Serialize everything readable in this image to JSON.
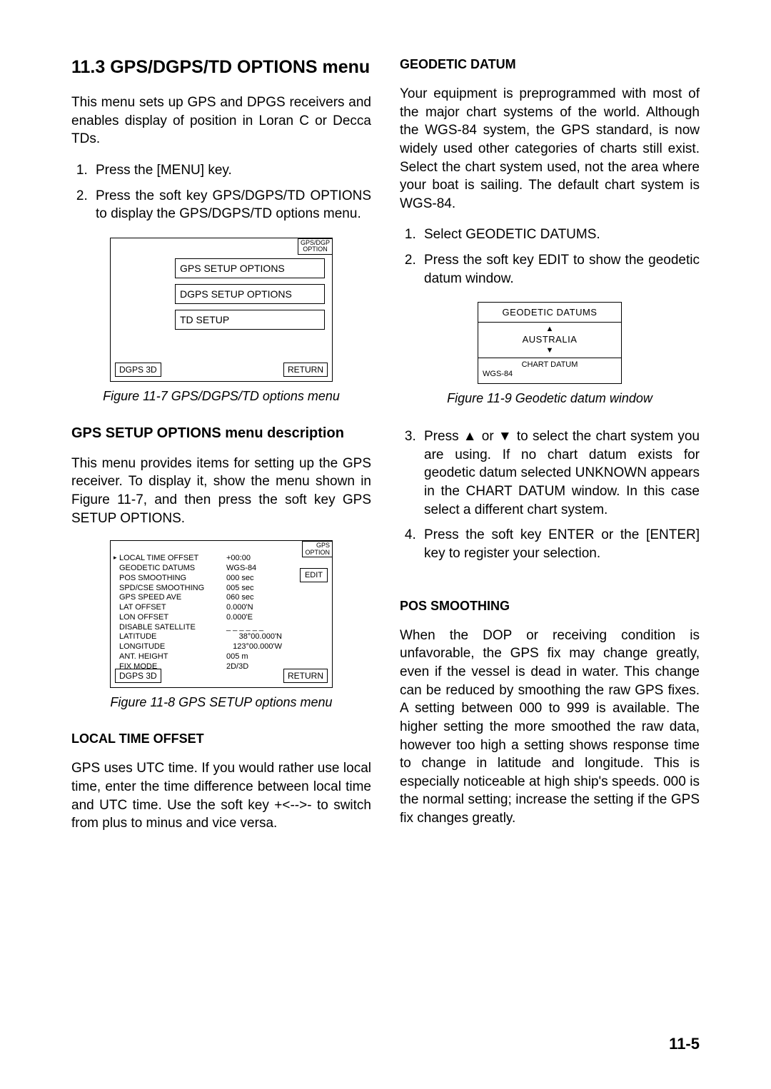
{
  "section": {
    "title": "11.3 GPS/DGPS/TD OPTIONS menu",
    "intro": "This menu sets up GPS and DPGS receivers and enables display of position in Loran C or Decca TDs.",
    "steps": [
      "Press the [MENU] key.",
      "Press the soft key GPS/DGPS/TD OPTIONS to display the GPS/DGPS/TD options menu."
    ]
  },
  "fig1": {
    "tag1": "GPS/DGP",
    "tag2": "OPTION",
    "items": [
      "GPS SETUP OPTIONS",
      "DGPS SETUP OPTIONS",
      "TD SETUP"
    ],
    "left": "DGPS 3D",
    "right": "RETURN",
    "caption": "Figure 11-7 GPS/DGPS/TD options menu"
  },
  "setup_menu": {
    "heading": "GPS SETUP OPTIONS menu description",
    "body": "This menu provides items for setting up the GPS receiver. To display it, show the menu shown in Figure 11-7, and then press the soft key GPS SETUP OPTIONS."
  },
  "fig2": {
    "tag1": "GPS",
    "tag2": "OPTION",
    "caret": "▸",
    "rows": [
      {
        "label": "LOCAL TIME OFFSET",
        "val": "+00:00"
      },
      {
        "label": "GEODETIC DATUMS",
        "val": "WGS-84"
      },
      {
        "label": "POS SMOOTHING",
        "val": "000 sec"
      },
      {
        "label": "SPD/CSE SMOOTHING",
        "val": "005 sec"
      },
      {
        "label": "GPS SPEED AVE",
        "val": "060 sec"
      },
      {
        "label": "LAT OFFSET",
        "val": "0.000'N"
      },
      {
        "label": "LON OFFSET",
        "val": "0.000'E"
      },
      {
        "label": "DISABLE SATELLITE",
        "val": "_ _ _ _ _ _"
      },
      {
        "label": "LATITUDE",
        "val": "38°00.000'N"
      },
      {
        "label": "LONGITUDE",
        "val": "123°00.000'W"
      },
      {
        "label": "ANT. HEIGHT",
        "val": "005 m"
      },
      {
        "label": "FIX MODE",
        "val": "2D/3D"
      }
    ],
    "edit": "EDIT",
    "left": "DGPS 3D",
    "right": "RETURN",
    "caption": "Figure 11-8 GPS SETUP options menu"
  },
  "local_time": {
    "heading": "LOCAL TIME OFFSET",
    "body": "GPS uses UTC time. If you would rather use local time, enter the time difference between local time and UTC time. Use the soft key +<-->- to switch from plus to minus and vice versa."
  },
  "geodetic": {
    "heading": "GEODETIC DATUM",
    "body": "Your equipment is preprogrammed with most of the major chart systems of the world. Although the WGS-84 system, the GPS standard,  is now widely used other categories of charts still exist. Select the chart system used, not the area where your boat is sailing. The default chart system is WGS-84.",
    "steps1": [
      "Select GEODETIC DATUMS.",
      "Press the soft key EDIT to show the geodetic datum window."
    ],
    "steps2": [
      "Press ▲ or ▼ to select the chart system you are using. If no chart datum exists for geodetic datum selected UNKNOWN appears in the CHART DATUM window. In this case select a different chart system.",
      "Press the soft key ENTER or the [ENTER] key to register your selection."
    ]
  },
  "fig3": {
    "title": "GEODETIC DATUMS",
    "up": "▲",
    "value": "AUSTRALIA",
    "down": "▼",
    "label": "CHART DATUM",
    "datum": "WGS-84",
    "caption": "Figure 11-9 Geodetic datum window"
  },
  "pos_smoothing": {
    "heading": "POS SMOOTHING",
    "body": "When the DOP or receiving condition is unfavorable, the GPS fix may change greatly, even if the vessel is dead in water. This change can be reduced by smoothing the raw GPS fixes. A setting between 000 to 999 is available. The higher setting the more smoothed the raw data, however too high a setting shows response time to change in latitude and longitude. This is especially noticeable at high ship's speeds. 000 is the normal setting; increase the setting if the GPS fix changes greatly."
  },
  "pagenum": "11-5"
}
